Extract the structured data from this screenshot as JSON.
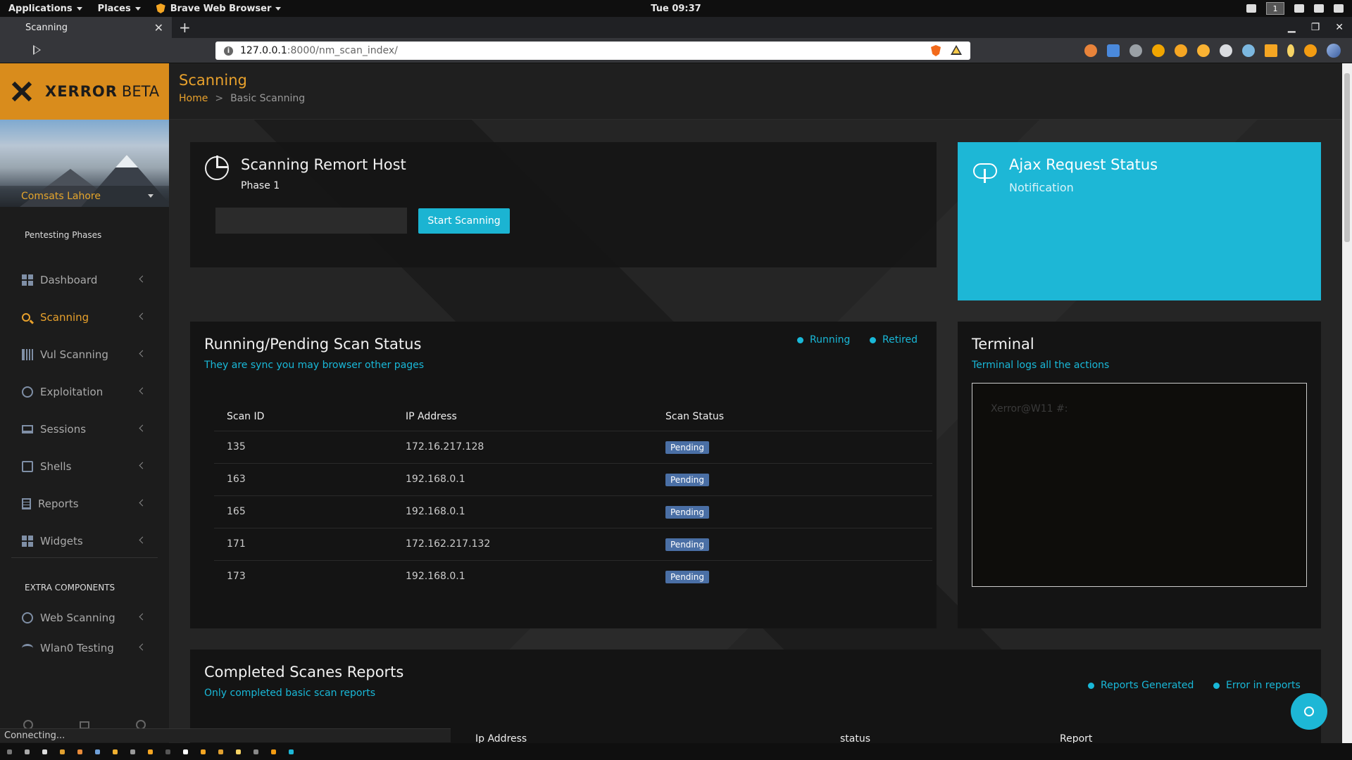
{
  "os_panel": {
    "menus": [
      "Applications",
      "Places",
      "Brave Web Browser"
    ],
    "clock": "Tue 09:37",
    "workspace": "1"
  },
  "browser": {
    "tab_title": "Scanning",
    "url_host": "127.0.0.1",
    "url_rest": ":8000/nm_scan_index/",
    "status_text": "Connecting..."
  },
  "brand": {
    "name": "XERROR",
    "tag": "BETA"
  },
  "profile": {
    "name": "Comsats Lahore"
  },
  "sidebar": {
    "heading": "Pentesting Phases",
    "items": [
      {
        "label": "Dashboard",
        "icon": "dashboard-icon"
      },
      {
        "label": "Scanning",
        "icon": "search-icon"
      },
      {
        "label": "Vul Scanning",
        "icon": "barcode-icon"
      },
      {
        "label": "Exploitation",
        "icon": "biohazard-icon"
      },
      {
        "label": "Sessions",
        "icon": "laptop-icon"
      },
      {
        "label": "Shells",
        "icon": "terminal-icon"
      },
      {
        "label": "Reports",
        "icon": "file-icon"
      },
      {
        "label": "Widgets",
        "icon": "widgets-icon"
      }
    ],
    "extra_heading": "EXTRA COMPONENTS",
    "extra_items": [
      {
        "label": "Web Scanning",
        "icon": "globe-icon"
      },
      {
        "label": "Wlan0 Testing",
        "icon": "wifi-icon"
      }
    ]
  },
  "header": {
    "title": "Scanning",
    "breadcrumb": [
      "Home",
      ">",
      "Basic Scanning"
    ]
  },
  "scan_card": {
    "title": "Scanning Remort Host",
    "subtitle": "Phase 1",
    "input_value": "",
    "button": "Start Scanning"
  },
  "ajax_card": {
    "title": "Ajax Request Status",
    "subtitle": "Notification"
  },
  "status_card": {
    "title": "Running/Pending Scan Status",
    "subtitle": "They are sync you may browser other pages",
    "legend": [
      "Running",
      "Retired"
    ],
    "columns": [
      "Scan ID",
      "IP Address",
      "Scan Status"
    ],
    "rows": [
      {
        "id": "135",
        "ip": "172.16.217.128",
        "status": "Pending"
      },
      {
        "id": "163",
        "ip": "192.168.0.1",
        "status": "Pending"
      },
      {
        "id": "165",
        "ip": "192.168.0.1",
        "status": "Pending"
      },
      {
        "id": "171",
        "ip": "172.162.217.132",
        "status": "Pending"
      },
      {
        "id": "173",
        "ip": "192.168.0.1",
        "status": "Pending"
      }
    ]
  },
  "terminal": {
    "title": "Terminal",
    "subtitle": "Terminal logs all the actions",
    "prompt": "Xerror@W11 #:"
  },
  "completed_card": {
    "title": "Completed Scanes Reports",
    "subtitle": "Only completed basic scan reports",
    "legend": [
      "Reports Generated",
      "Error in reports"
    ],
    "columns": [
      "Ip Address",
      "status",
      "Report"
    ]
  },
  "colors": {
    "accent_orange": "#e8a12c",
    "accent_cyan": "#1db7d6",
    "badge_blue": "#4a6fa5"
  }
}
